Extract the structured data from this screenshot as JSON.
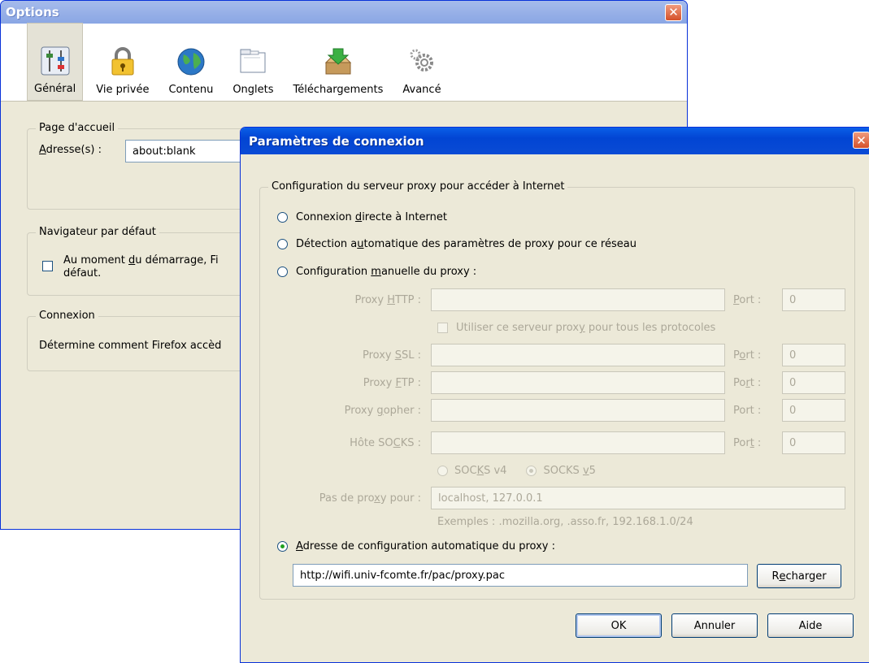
{
  "options": {
    "title": "Options",
    "close_symbol": "✕",
    "toolbar": [
      {
        "label": "Général",
        "icon": "general-icon",
        "selected": true
      },
      {
        "label": "Vie privée",
        "icon": "padlock-icon",
        "selected": false
      },
      {
        "label": "Contenu",
        "icon": "globe-icon",
        "selected": false
      },
      {
        "label": "Onglets",
        "icon": "tabs-icon",
        "selected": false
      },
      {
        "label": "Téléchargements",
        "icon": "download-box-icon",
        "selected": false
      },
      {
        "label": "Avancé",
        "icon": "gears-icon",
        "selected": false
      }
    ],
    "homepage": {
      "legend": "Page d'accueil",
      "address_label_u": "A",
      "address_label_rest": "dresse(s) :",
      "address_value": "about:blank"
    },
    "default_browser": {
      "legend": "Navigateur par défaut",
      "checkbox_text_1a": "Au moment ",
      "checkbox_text_1u": "d",
      "checkbox_text_1b": "u démarrage, Fi",
      "checkbox_text_2": "défaut."
    },
    "connection": {
      "legend": "Connexion",
      "text": "Détermine comment Firefox accèd"
    }
  },
  "dialog": {
    "title": "Paramètres de connexion",
    "close_symbol": "✕",
    "group_legend": "Configuration du serveur proxy pour accéder à Internet",
    "radio_direct": {
      "a": "Connexion ",
      "u": "d",
      "b": "irecte à Internet"
    },
    "radio_auto_detect": {
      "a": "Détection a",
      "u": "u",
      "b": "tomatique des paramètres de proxy pour ce réseau"
    },
    "radio_manual": {
      "a": "Configuration ",
      "u": "m",
      "b": "anuelle du proxy :"
    },
    "http": {
      "a": "Proxy ",
      "u": "H",
      "b": "TTP :",
      "port_u": "P",
      "port_b": "ort :",
      "port_value": "0"
    },
    "use_for_all": {
      "a": "Utiliser ce serveur prox",
      "u": "y",
      "b": " pour tous les protocoles"
    },
    "ssl": {
      "a": "Proxy ",
      "u": "S",
      "b": "SL :",
      "port_a": "P",
      "port_u": "o",
      "port_b": "rt :",
      "port_value": "0"
    },
    "ftp": {
      "a": "Proxy ",
      "u": "F",
      "b": "TP :",
      "port_a": "Po",
      "port_u": "r",
      "port_b": "t :",
      "port_value": "0"
    },
    "gopher": {
      "a": "Proxy ",
      "u": "g",
      "b": "opher :",
      "port_label": "Port :",
      "port_value": "0"
    },
    "socks": {
      "a": "Hôte SO",
      "u": "C",
      "b": "KS :",
      "port_a": "Por",
      "port_u": "t",
      "port_b": " :",
      "port_value": "0"
    },
    "socks_v4": {
      "a": "SOC",
      "u": "K",
      "b": "S v4"
    },
    "socks_v5": {
      "a": "SOCKS ",
      "u": "v",
      "b": "5"
    },
    "no_proxy": {
      "a": "Pas de pro",
      "u": "x",
      "b": "y pour :",
      "value": "localhost, 127.0.0.1"
    },
    "examples": "Exemples : .mozilla.org, .asso.fr, 192.168.1.0/24",
    "radio_pac": {
      "u": "A",
      "b": "dresse de configuration automatique du proxy :"
    },
    "pac_url": "http://wifi.univ-fcomte.fr/pac/proxy.pac",
    "reload": {
      "a": "R",
      "u": "e",
      "b": "charger"
    },
    "ok": "OK",
    "cancel": "Annuler",
    "help": "Aide"
  }
}
